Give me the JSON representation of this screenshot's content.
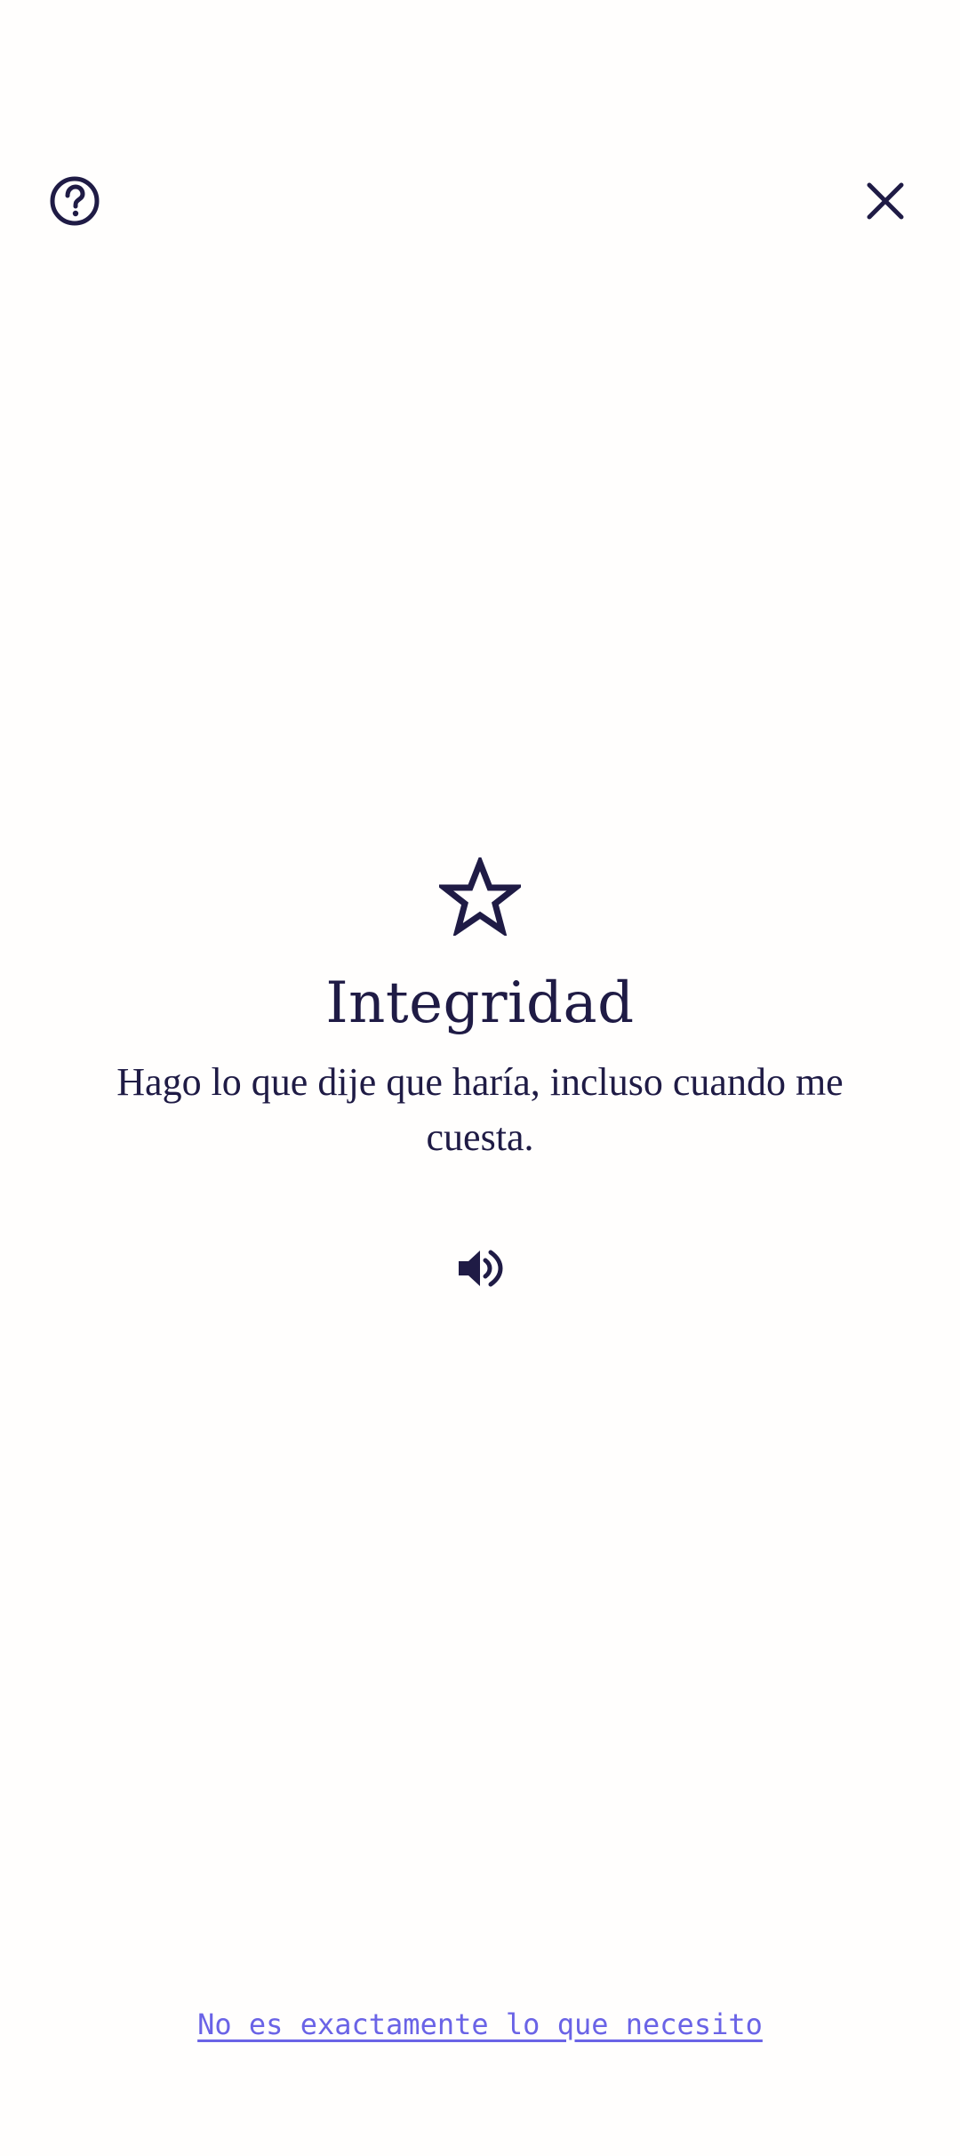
{
  "header": {
    "help_icon": "help-circle-icon",
    "close_icon": "close-icon"
  },
  "value": {
    "icon": "star-outline-icon",
    "title": "Integridad",
    "description": "Hago lo que dije que haría, incluso cuando me cuesta.",
    "audio_icon": "speaker-icon"
  },
  "footer": {
    "link_label": "No es exactamente lo que necesito"
  },
  "colors": {
    "text_primary": "#1F1B45",
    "link": "#6A63E6",
    "background": "#FFFEFD"
  }
}
